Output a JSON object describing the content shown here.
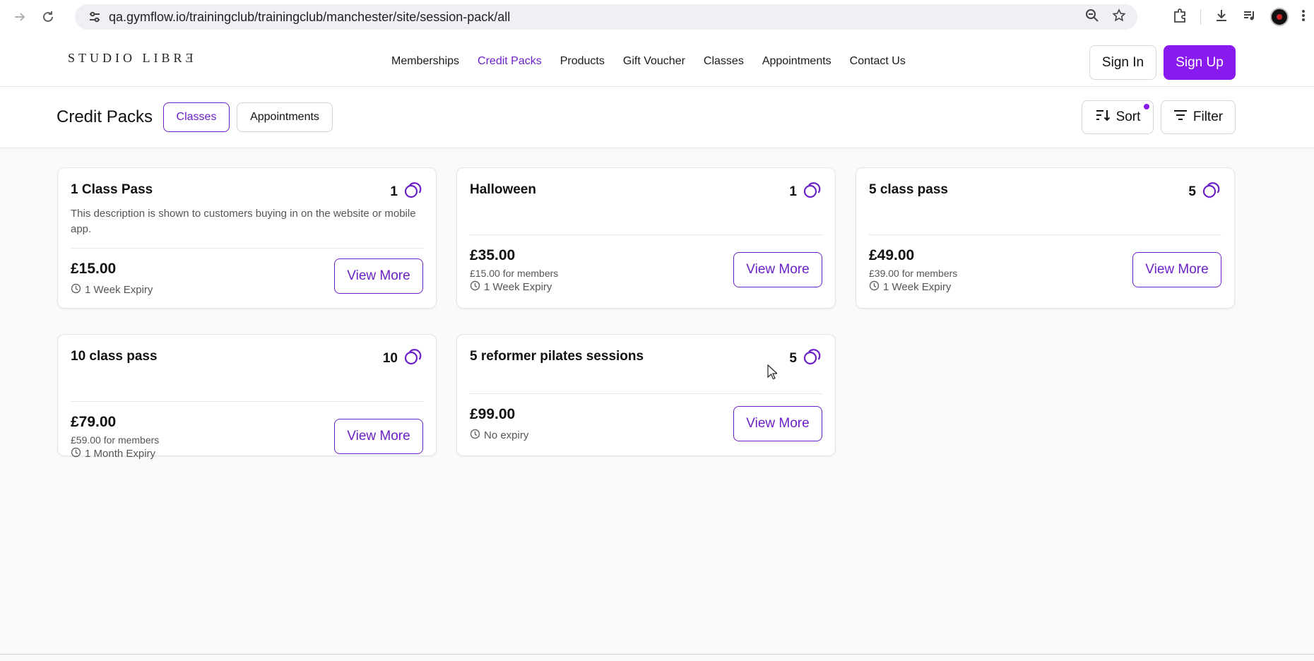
{
  "browser": {
    "url": "qa.gymflow.io/trainingclub/trainingclub/manchester/site/session-pack/all"
  },
  "header": {
    "logo": "STUDIO LIBRƎ",
    "nav": [
      "Memberships",
      "Credit Packs",
      "Products",
      "Gift Voucher",
      "Classes",
      "Appointments",
      "Contact Us"
    ],
    "active_nav": "Credit Packs",
    "sign_in": "Sign In",
    "sign_up": "Sign Up"
  },
  "toolbar": {
    "title": "Credit Packs",
    "chips": [
      "Classes",
      "Appointments"
    ],
    "selected_chip": "Classes",
    "sort_label": "Sort",
    "filter_label": "Filter"
  },
  "cards": [
    {
      "title": "1 Class Pass",
      "count": "1",
      "description": "This description is shown to customers buying in on the website or mobile app.",
      "price": "£15.00",
      "member_price": "",
      "expiry": "1 Week Expiry",
      "button": "View More"
    },
    {
      "title": "Halloween",
      "count": "1",
      "description": "",
      "price": "£35.00",
      "member_price": "£15.00 for members",
      "expiry": "1 Week Expiry",
      "button": "View More"
    },
    {
      "title": "5 class pass",
      "count": "5",
      "description": "",
      "price": "£49.00",
      "member_price": "£39.00 for members",
      "expiry": "1 Week Expiry",
      "button": "View More"
    },
    {
      "title": "10 class pass",
      "count": "10",
      "description": "",
      "price": "£79.00",
      "member_price": "£59.00 for members",
      "expiry": "1 Month Expiry",
      "button": "View More"
    },
    {
      "title": "5 reformer pilates sessions",
      "count": "5",
      "description": "",
      "price": "£99.00",
      "member_price": "",
      "expiry": "No expiry",
      "button": "View More"
    }
  ],
  "colors": {
    "accent": "#6b21c8",
    "signup": "#8a1bf0"
  },
  "icons": [
    "back-icon",
    "forward-icon",
    "reload-icon",
    "site-settings-icon",
    "zoom-icon",
    "bookmark-star-icon",
    "extensions-icon",
    "download-icon",
    "media-icon",
    "profile-avatar",
    "menu-icon",
    "sort-icon",
    "filter-icon",
    "credits-icon",
    "clock-icon"
  ]
}
